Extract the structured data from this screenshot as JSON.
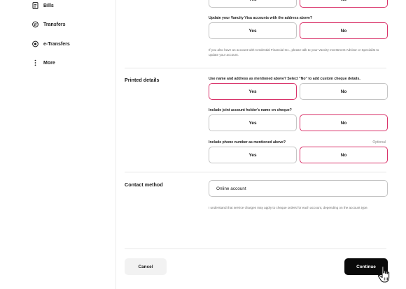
{
  "sidebar": {
    "items": [
      {
        "label": "Bills",
        "icon": "receipt-icon"
      },
      {
        "label": "Transfers",
        "icon": "transfer-icon"
      },
      {
        "label": "e-Transfers",
        "icon": "etransfer-icon"
      },
      {
        "label": "More",
        "icon": "more-vertical-icon"
      }
    ]
  },
  "address_section": {
    "top_options": {
      "yes": "Yes",
      "no": "No",
      "selected": "no"
    },
    "visa_question": "Update your Vancity Visa accounts with the address above?",
    "visa_options": {
      "yes": "Yes",
      "no": "No",
      "selected": "no"
    },
    "help_text": "If you also have an account with Credential Financial Inc., please talk to your Vancity Investment Advisor or Specialist to update your account."
  },
  "printed_details": {
    "title": "Printed details",
    "q1": {
      "label": "Use name and address as mentioned above? Select \"No\" to add custom cheque details.",
      "yes": "Yes",
      "no": "No",
      "selected": "yes"
    },
    "q2": {
      "label": "Include joint account holder's name on cheque?",
      "yes": "Yes",
      "no": "No",
      "selected": "no"
    },
    "q3": {
      "label": "Include phone number as mentioned above?",
      "optional": "Optional",
      "yes": "Yes",
      "no": "No",
      "selected": "no"
    }
  },
  "contact": {
    "title": "Contact method",
    "value": "Online account",
    "note": "I understand that service charges may apply to cheque orders for each account, depending on the account type."
  },
  "actions": {
    "cancel": "Cancel",
    "continue": "Continue"
  },
  "colors": {
    "accent": "#d9336a",
    "primary_button": "#0a0a0a"
  }
}
